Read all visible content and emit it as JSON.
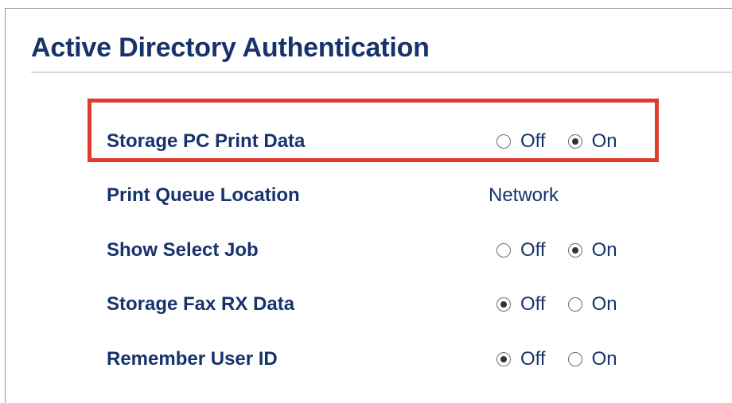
{
  "page": {
    "title": "Active Directory Authentication"
  },
  "colors": {
    "title": "#16336b",
    "highlight": "#e03c2e"
  },
  "settings": [
    {
      "label": "Storage PC Print Data",
      "type": "radio",
      "options": [
        {
          "label": "Off",
          "checked": false
        },
        {
          "label": "On",
          "checked": true
        }
      ],
      "highlighted": true
    },
    {
      "label": "Print Queue Location",
      "type": "text",
      "value": "Network"
    },
    {
      "label": "Show Select Job",
      "type": "radio",
      "options": [
        {
          "label": "Off",
          "checked": false
        },
        {
          "label": "On",
          "checked": true
        }
      ]
    },
    {
      "label": "Storage Fax RX Data",
      "type": "radio",
      "options": [
        {
          "label": "Off",
          "checked": true
        },
        {
          "label": "On",
          "checked": false
        }
      ]
    },
    {
      "label": "Remember User ID",
      "type": "radio",
      "options": [
        {
          "label": "Off",
          "checked": true
        },
        {
          "label": "On",
          "checked": false
        }
      ]
    }
  ]
}
